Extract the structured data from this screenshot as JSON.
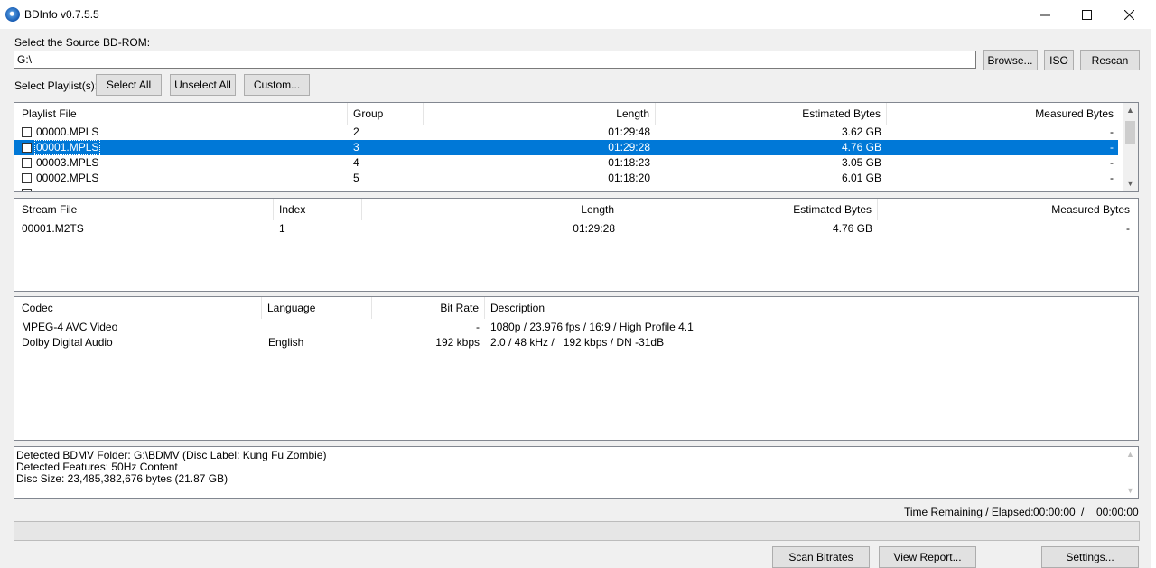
{
  "window": {
    "title": "BDInfo v0.7.5.5",
    "minimize_icon": "minimize-icon",
    "maximize_icon": "maximize-icon",
    "close_icon": "close-icon"
  },
  "source": {
    "label": "Select the Source BD-ROM:",
    "path": "G:\\",
    "browse_label": "Browse...",
    "iso_label": "ISO",
    "rescan_label": "Rescan"
  },
  "playlist_controls": {
    "label": "Select Playlist(s):",
    "select_all_label": "Select All",
    "unselect_all_label": "Unselect All",
    "custom_label": "Custom..."
  },
  "playlists": {
    "headers": [
      "Playlist File",
      "Group",
      "Length",
      "Estimated Bytes",
      "Measured Bytes"
    ],
    "rows": [
      {
        "file": "00000.MPLS",
        "group": "2",
        "length": "01:29:48",
        "estimated": "3.62 GB",
        "measured": "-",
        "selected": false
      },
      {
        "file": "00001.MPLS",
        "group": "3",
        "length": "01:29:28",
        "estimated": "4.76 GB",
        "measured": "-",
        "selected": true
      },
      {
        "file": "00003.MPLS",
        "group": "4",
        "length": "01:18:23",
        "estimated": "3.05 GB",
        "measured": "-",
        "selected": false
      },
      {
        "file": "00002.MPLS",
        "group": "5",
        "length": "01:18:20",
        "estimated": "6.01 GB",
        "measured": "-",
        "selected": false
      }
    ]
  },
  "streams": {
    "headers": [
      "Stream File",
      "Index",
      "Length",
      "Estimated Bytes",
      "Measured Bytes"
    ],
    "rows": [
      {
        "file": "00001.M2TS",
        "index": "1",
        "length": "01:29:28",
        "estimated": "4.76 GB",
        "measured": "-"
      }
    ]
  },
  "codecs": {
    "headers": [
      "Codec",
      "Language",
      "Bit Rate",
      "Description"
    ],
    "rows": [
      {
        "codec": "MPEG-4 AVC Video",
        "language": "",
        "bitrate": "-",
        "description": "1080p / 23.976 fps / 16:9 / High Profile 4.1"
      },
      {
        "codec": "Dolby Digital Audio",
        "language": "English",
        "bitrate": "192 kbps",
        "description": "2.0 / 48 kHz /   192 kbps / DN -31dB"
      }
    ]
  },
  "info": {
    "lines": [
      "Detected BDMV Folder: G:\\BDMV (Disc Label: Kung Fu Zombie)",
      "Detected Features: 50Hz Content",
      "Disc Size: 23,485,382,676 bytes (21.87 GB)"
    ]
  },
  "time": {
    "label": "Time Remaining / Elapsed:",
    "remaining": "00:00:00",
    "separator": "/",
    "elapsed": "00:00:00"
  },
  "progress": {
    "fraction": 0
  },
  "actions": {
    "scan_label": "Scan Bitrates",
    "report_label": "View Report...",
    "settings_label": "Settings..."
  }
}
